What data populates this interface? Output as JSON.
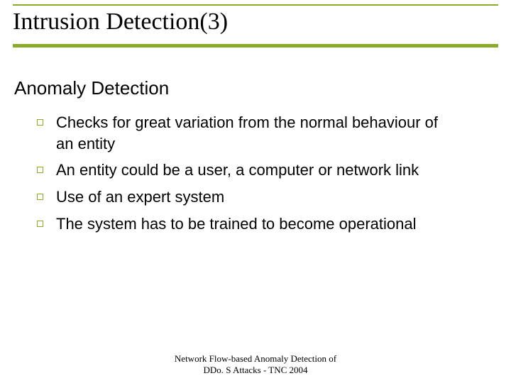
{
  "title": "Intrusion Detection(3)",
  "subtitle": "Anomaly Detection",
  "bullets": [
    "Checks for great variation from the normal behaviour of an entity",
    "An entity could be a user, a computer or network link",
    "Use of an expert system",
    "The system has to be trained to become operational"
  ],
  "footer": {
    "line1": "Network Flow-based Anomaly Detection of",
    "line2": "DDo. S Attacks - TNC 2004"
  }
}
